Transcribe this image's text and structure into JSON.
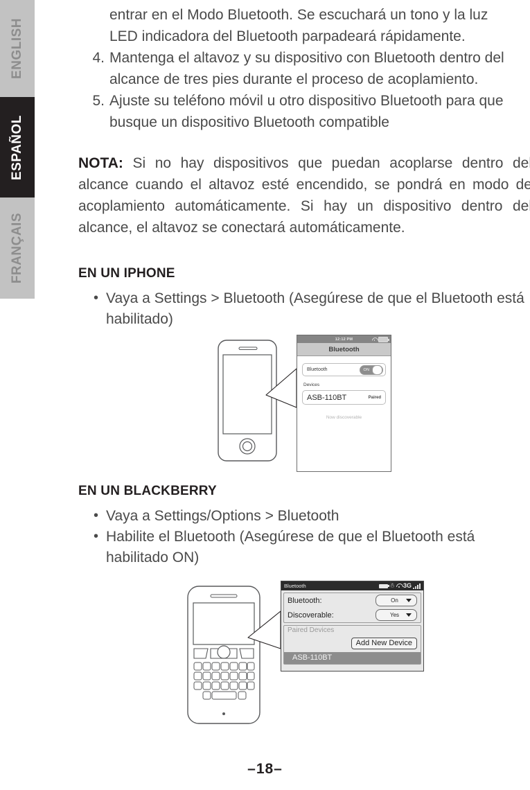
{
  "sidebar": {
    "tabs": [
      {
        "label": "ENGLISH",
        "active": false
      },
      {
        "label": "ESPAÑOL",
        "active": true
      },
      {
        "label": "FRANÇAIS",
        "active": false
      }
    ]
  },
  "body": {
    "continued_lines": [
      "entrar en el Modo Bluetooth. Se escuchará un tono y la luz",
      "LED indicadora del Bluetooth parpadeará rápidamente."
    ],
    "steps": [
      {
        "number": "4.",
        "text": "Mantenga el altavoz y su dispositivo con Bluetooth dentro del alcance de tres pies durante el proceso de acoplamiento."
      },
      {
        "number": "5.",
        "text": "Ajuste su teléfono móvil u otro dispositivo Bluetooth para que busque un dispositivo Bluetooth compatible"
      }
    ],
    "note": {
      "label": "NOTA:",
      "text": "Si no hay dispositivos que puedan acoplarse dentro del alcance cuando el altavoz esté encendido, se pondrá en modo de acoplamiento automáticamente. Si hay un dispositivo dentro del alcance, el altavoz se conectará automáticamente."
    },
    "iphone_section": {
      "heading": "EN UN IPHONE",
      "bullets": [
        "Vaya a Settings > Bluetooth (Asegúrese de que el Bluetooth está habilitado)"
      ]
    },
    "blackberry_section": {
      "heading": "EN UN BLACKBERRY",
      "bullets": [
        "Vaya a Settings/Options > Bluetooth",
        "Habilite el Bluetooth (Asegúrese de que el Bluetooth está habilitado ON)"
      ]
    }
  },
  "iphone_screen": {
    "status_time": "12:12 PM",
    "nav_title": "Bluetooth",
    "bluetooth_row_label": "Bluetooth",
    "toggle_state": "ON",
    "devices_label": "Devices",
    "device_name": "ASB-110BT",
    "device_status": "Paired",
    "discoverable_text": "Now discoverable"
  },
  "blackberry_screen": {
    "title": "Bluetooth",
    "network": "3G",
    "bluetooth_label": "Bluetooth:",
    "bluetooth_value": "On",
    "discoverable_label": "Discoverable:",
    "discoverable_value": "Yes",
    "paired_devices_label": "Paired Devices",
    "add_device_button": "Add New Device",
    "paired_device_name": "ASB-110BT"
  },
  "footer": {
    "page_number": "–18–"
  },
  "colors": {
    "tab_active_bg": "#231f20",
    "tab_inactive_bg": "#c2c2c2",
    "body_text": "#4a4a4a",
    "heading_text": "#231f20"
  }
}
